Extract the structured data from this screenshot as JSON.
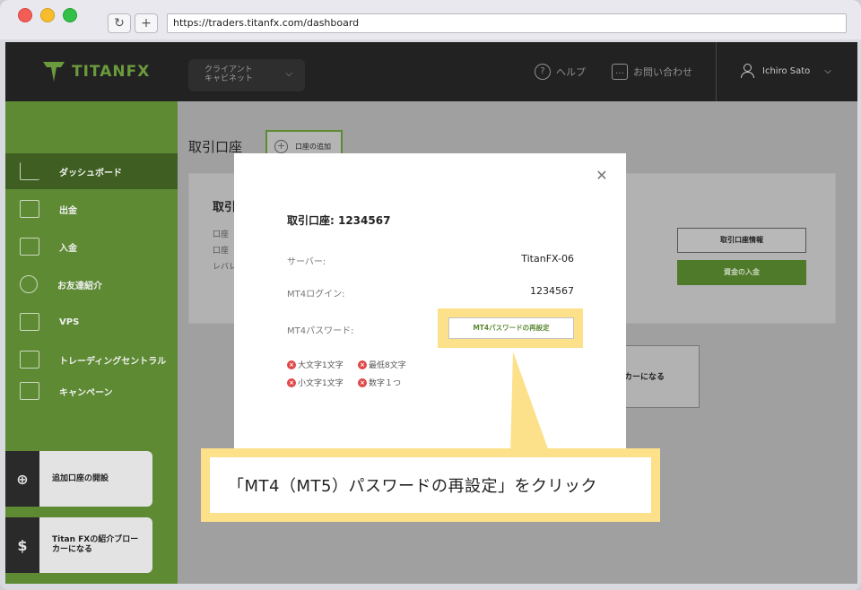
{
  "browser": {
    "url": "https://traders.titanfx.com/dashboard",
    "reload_glyph": "↻",
    "newtab_glyph": "+"
  },
  "header": {
    "logo_text": "TITANFX",
    "portal_line1": "クライアント",
    "portal_line2": "キャビネット",
    "help": "ヘルプ",
    "contact": "お問い合わせ",
    "user_name": "Ichiro Sato"
  },
  "sidebar": {
    "items": [
      {
        "label": "ダッシュボード",
        "icon": "bar-chart-icon"
      },
      {
        "label": "出金",
        "icon": "withdraw-icon"
      },
      {
        "label": "入金",
        "icon": "deposit-icon"
      },
      {
        "label": "お友達紹介",
        "icon": "friends-icon"
      },
      {
        "label": "VPS",
        "icon": "server-icon"
      },
      {
        "label": "トレーディングセントラル",
        "icon": "monitor-chart-icon"
      },
      {
        "label": "キャンペーン",
        "icon": "star-badge-icon"
      }
    ],
    "add_account": "追加口座の開設",
    "ib_line1": "Titan FXの紹介ブロー",
    "ib_line2": "カーになる"
  },
  "main": {
    "title": "取引口座",
    "add_button": "口座の追加",
    "card_title": "取引",
    "row1": "口座",
    "row2": "口座",
    "row3": "レバレ",
    "info_button": "取引口座情報",
    "deposit_button": "資金の入金",
    "ib_card": "ーカーになる"
  },
  "modal": {
    "title": "取引口座: 1234567",
    "server_label": "サーバー:",
    "server_value": "TitanFX-06",
    "login_label": "MT4ログイン:",
    "login_value": "1234567",
    "password_label": "MT4パスワード:",
    "reset_button": "MT4パスワードの再設定",
    "requirements": [
      "大文字1文字",
      "最低8文字",
      "小文字1文字",
      "数字１つ"
    ]
  },
  "callout": {
    "text": "「MT4（MT5）パスワードの再設定」をクリック"
  },
  "colors": {
    "brand_green": "#5d8a33",
    "highlight": "#fde08a",
    "error": "#e04848"
  }
}
